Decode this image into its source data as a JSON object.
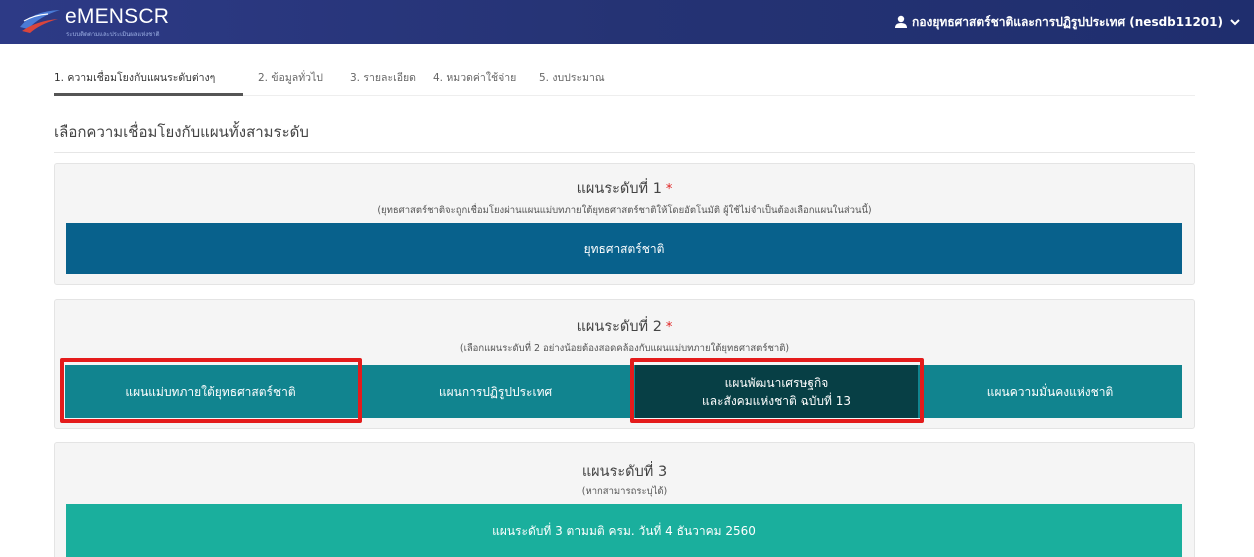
{
  "header": {
    "app_title": "eMENSCR",
    "app_subtitle": "ระบบติดตามและประเมินผลแห่งชาติ",
    "user_label": "กองยุทธศาสตร์ชาติและการปฏิรูปประเทศ (nesdb11201)",
    "icons": {
      "user": "user-icon",
      "caret": "chevron-down-icon"
    },
    "colors": {
      "navbar": "#253374"
    }
  },
  "tabs": [
    {
      "label": "1. ความเชื่อมโยงกับแผนระดับต่างๆ",
      "active": true
    },
    {
      "label": "2. ข้อมูลทั่วไป",
      "active": false
    },
    {
      "label": "3. รายละเอียด",
      "active": false
    },
    {
      "label": "4. หมวดค่าใช้จ่าย",
      "active": false
    },
    {
      "label": "5. งบประมาณ",
      "active": false
    }
  ],
  "section": {
    "title": "เลือกความเชื่อมโยงกับแผนทั้งสามระดับ"
  },
  "level1": {
    "title": "แผนระดับที่ 1",
    "required_mark": "*",
    "note": "(ยุทธศาสตร์ชาติจะถูกเชื่อมโยงผ่านแผนแม่บทภายใต้ยุทธศาสตร์ชาติให้โดยอัตโนมัติ ผู้ใช้ไม่จำเป็นต้องเลือกแผนในส่วนนี้)",
    "button": "ยุทธศาสตร์ชาติ"
  },
  "level2": {
    "title": "แผนระดับที่ 2",
    "required_mark": "*",
    "note": "(เลือกแผนระดับที่ 2 อย่างน้อยต้องสอดคล้องกับแผนแม่บทภายใต้ยุทธศาสตร์ชาติ)",
    "options": [
      {
        "label": "แผนแม่บทภายใต้ยุทธศาสตร์ชาติ",
        "selected": false,
        "highlighted": true
      },
      {
        "label": "แผนการปฏิรูปประเทศ",
        "selected": false,
        "highlighted": false
      },
      {
        "label_line1": "แผนพัฒนาเศรษฐกิจ",
        "label_line2": "และสังคมแห่งชาติ ฉบับที่ 13",
        "selected": true,
        "highlighted": true
      },
      {
        "label": "แผนความมั่นคงแห่งชาติ",
        "selected": false,
        "highlighted": false
      }
    ]
  },
  "level3": {
    "title": "แผนระดับที่ 3",
    "note": "(หากสามารถระบุได้)",
    "button": "แผนระดับที่ 3 ตามมติ ครม. วันที่ 4 ธันวาคม 2560"
  },
  "colors": {
    "level1_button": "#08618c",
    "level2_button": "#11848f",
    "level2_selected": "#073f45",
    "level3_button": "#1aaf9d",
    "highlight": "#e41b1b",
    "required": "#e02020"
  }
}
